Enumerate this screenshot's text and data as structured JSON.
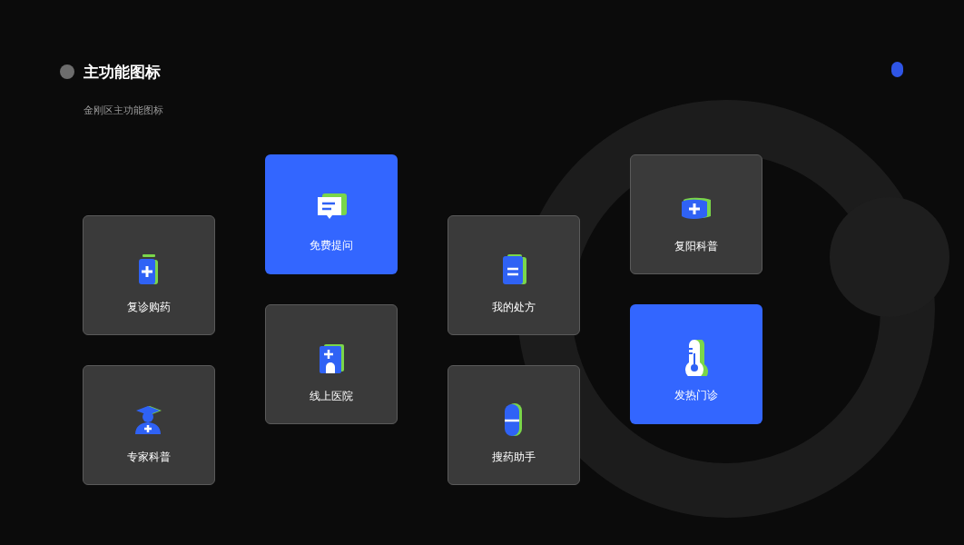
{
  "header": {
    "title": "主功能图标",
    "subtitle": "金刚区主功能图标"
  },
  "columns": [
    {
      "cards": [
        {
          "label": "复诊购药",
          "highlighted": false
        },
        {
          "label": "专家科普",
          "highlighted": false
        }
      ]
    },
    {
      "cards": [
        {
          "label": "免费提问",
          "highlighted": true
        },
        {
          "label": "线上医院",
          "highlighted": false
        }
      ]
    },
    {
      "cards": [
        {
          "label": "我的处方",
          "highlighted": false
        },
        {
          "label": "搜药助手",
          "highlighted": false
        }
      ]
    },
    {
      "cards": [
        {
          "label": "复阳科普",
          "highlighted": false
        },
        {
          "label": "发热门诊",
          "highlighted": true
        }
      ]
    }
  ]
}
